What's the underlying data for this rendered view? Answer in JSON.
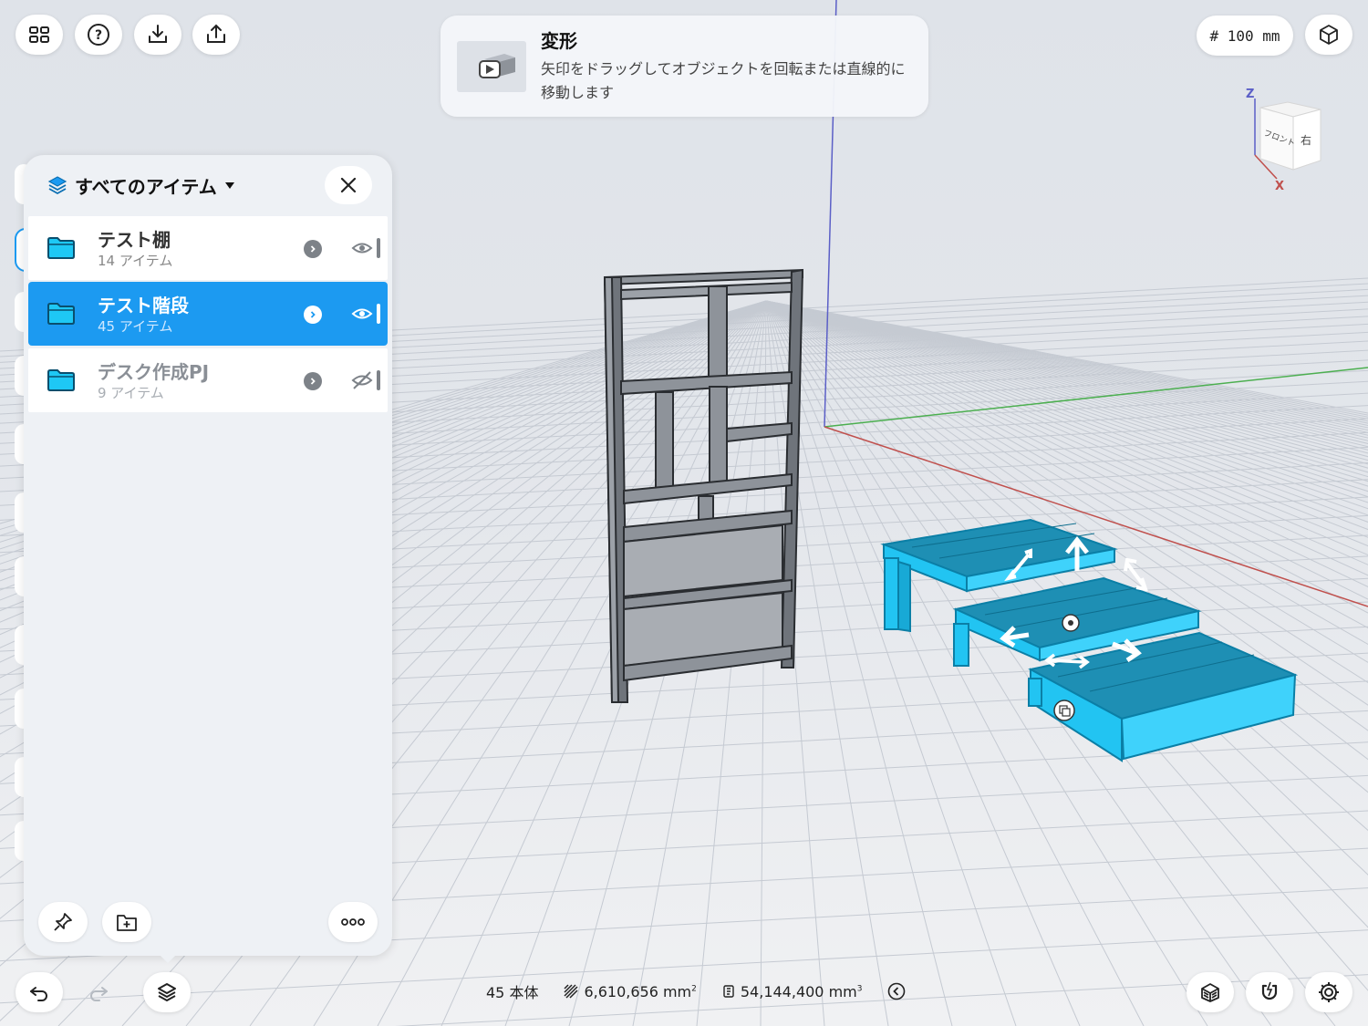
{
  "hint": {
    "title": "変形",
    "text": "矢印をドラッグしてオブジェクトを回転または直線的に移動します"
  },
  "grid_size": "# 100 mm",
  "view_cube": {
    "axis_z": "Z",
    "axis_x": "X",
    "face_front": "フロント",
    "face_right": "右"
  },
  "panel": {
    "title": "すべてのアイテム",
    "folders": [
      {
        "name": "テスト棚",
        "count": "14 アイテム",
        "visible": true,
        "selected": false
      },
      {
        "name": "テスト階段",
        "count": "45 アイテム",
        "visible": true,
        "selected": true
      },
      {
        "name": "デスク作成PJ",
        "count": "9 アイテム",
        "visible": false,
        "selected": false
      }
    ]
  },
  "status": {
    "bodies": "45 本体",
    "area_value": "6,610,656 mm",
    "area_exp": "2",
    "volume_value": "54,144,400 mm",
    "volume_exp": "3"
  },
  "colors": {
    "selection": "#1c9af1",
    "model_highlight": "#22c4f2",
    "axis_red": "#c0504d",
    "axis_green": "#4caf50",
    "axis_blue": "#5b5fc7"
  },
  "icons": {
    "top_left": [
      "grid-menu-icon",
      "help-icon",
      "import-icon",
      "export-icon"
    ],
    "top_right": [
      "view-mode-icon"
    ],
    "bottom_left": [
      "undo-icon",
      "redo-icon",
      "layers-icon"
    ],
    "bottom_right": [
      "material-icon",
      "snap-magnet-icon",
      "settings-gear-icon"
    ]
  }
}
